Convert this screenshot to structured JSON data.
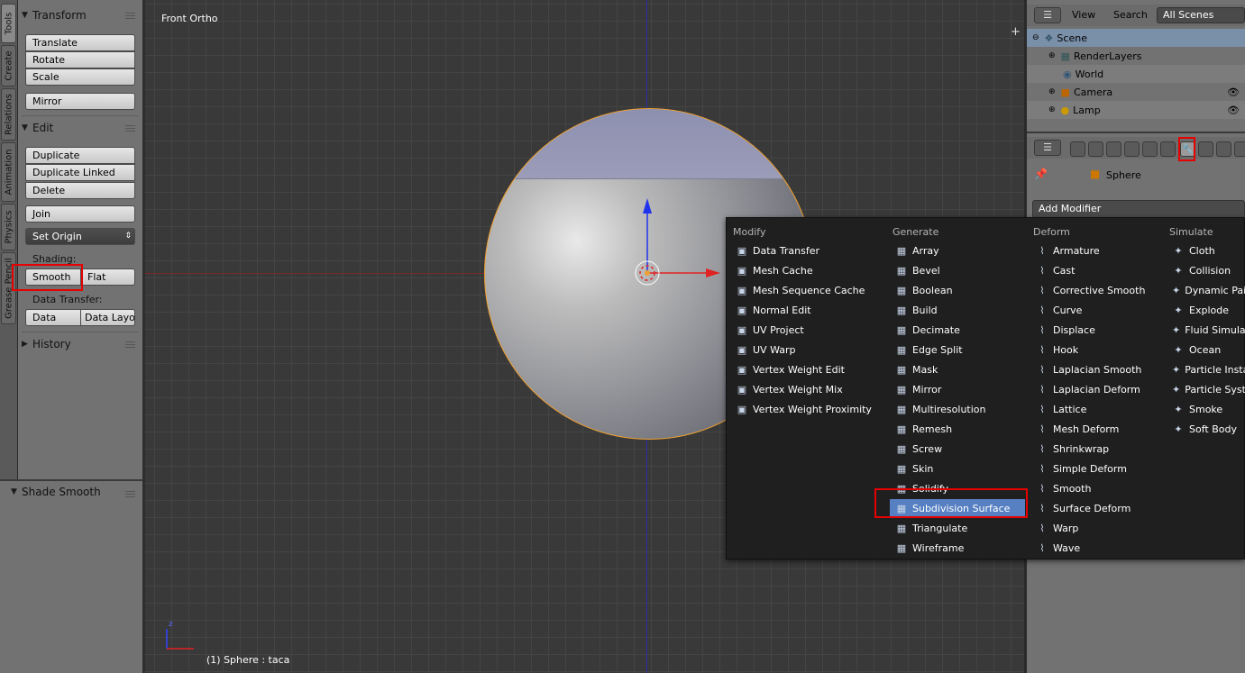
{
  "vtabs": [
    "Tools",
    "Create",
    "Relations",
    "Animation",
    "Physics",
    "Grease Pencil"
  ],
  "toolshelf": {
    "transform": {
      "title": "Transform",
      "translate": "Translate",
      "rotate": "Rotate",
      "scale": "Scale",
      "mirror": "Mirror"
    },
    "edit": {
      "title": "Edit",
      "duplicate": "Duplicate",
      "duplicate_linked": "Duplicate Linked",
      "delete": "Delete",
      "join": "Join",
      "set_origin": "Set Origin",
      "shading_label": "Shading:",
      "smooth": "Smooth",
      "flat": "Flat",
      "data_transfer_label": "Data Transfer:",
      "data": "Data",
      "data_layout": "Data Layo"
    },
    "history": "History",
    "operator_panel": "Shade Smooth"
  },
  "viewport": {
    "title": "Front Ortho",
    "status": "(1) Sphere : taca",
    "axis_x": "",
    "axis_z": "z"
  },
  "outliner": {
    "view": "View",
    "search": "Search",
    "scene_select": "All Scenes",
    "rows": [
      "Scene",
      "RenderLayers",
      "World",
      "Camera",
      "Lamp"
    ]
  },
  "properties": {
    "object_name": "Sphere",
    "add_modifier": "Add Modifier"
  },
  "menu": {
    "modify": {
      "title": "Modify",
      "items": [
        "Data Transfer",
        "Mesh Cache",
        "Mesh Sequence Cache",
        "Normal Edit",
        "UV Project",
        "UV Warp",
        "Vertex Weight Edit",
        "Vertex Weight Mix",
        "Vertex Weight Proximity"
      ]
    },
    "generate": {
      "title": "Generate",
      "items": [
        "Array",
        "Bevel",
        "Boolean",
        "Build",
        "Decimate",
        "Edge Split",
        "Mask",
        "Mirror",
        "Multiresolution",
        "Remesh",
        "Screw",
        "Skin",
        "Solidify",
        "Subdivision Surface",
        "Triangulate",
        "Wireframe"
      ]
    },
    "deform": {
      "title": "Deform",
      "items": [
        "Armature",
        "Cast",
        "Corrective Smooth",
        "Curve",
        "Displace",
        "Hook",
        "Laplacian Smooth",
        "Laplacian Deform",
        "Lattice",
        "Mesh Deform",
        "Shrinkwrap",
        "Simple Deform",
        "Smooth",
        "Surface Deform",
        "Warp",
        "Wave"
      ]
    },
    "simulate": {
      "title": "Simulate",
      "items": [
        "Cloth",
        "Collision",
        "Dynamic Pai",
        "Explode",
        "Fluid Simulat",
        "Ocean",
        "Particle Insta",
        "Particle Syst",
        "Smoke",
        "Soft Body"
      ]
    },
    "highlighted": "Subdivision Surface"
  },
  "colors": {
    "highlight": "#5680c2",
    "annotation": "#e60000",
    "selection_outline": "#f0a030"
  }
}
